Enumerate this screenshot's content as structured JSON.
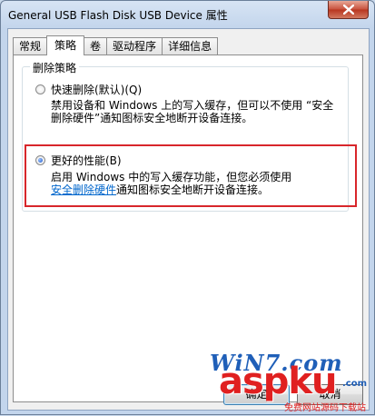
{
  "window": {
    "title": "General USB Flash Disk USB Device 属性",
    "close_icon": "close-x-icon"
  },
  "tabs": [
    {
      "label": "常规",
      "active": false
    },
    {
      "label": "策略",
      "active": true
    },
    {
      "label": "卷",
      "active": false
    },
    {
      "label": "驱动程序",
      "active": false
    },
    {
      "label": "详细信息",
      "active": false
    }
  ],
  "removal_policy": {
    "group_title": "删除策略",
    "options": [
      {
        "label": "快速删除(默认)(Q)",
        "selected": false,
        "desc_line1": "禁用设备和 Windows 上的写入缓存，但可以不使用 “安全",
        "desc_line2": "删除硬件”通知图标安全地断开设备连接。"
      },
      {
        "label": "更好的性能(B)",
        "selected": true,
        "desc_line1": "启用 Windows 中的写入缓存功能，但您必须使用",
        "desc_link": "安全删除硬件",
        "desc_line2_rest": "通知图标安全地断开设备连接。"
      }
    ],
    "highlight_color": "#d8262b"
  },
  "buttons": {
    "ok": "确定",
    "cancel": "取消"
  },
  "watermark": {
    "win7": "WiN7.com",
    "aspku": "aspku",
    "com": ".com",
    "cn": "免费网站源码下载站"
  }
}
